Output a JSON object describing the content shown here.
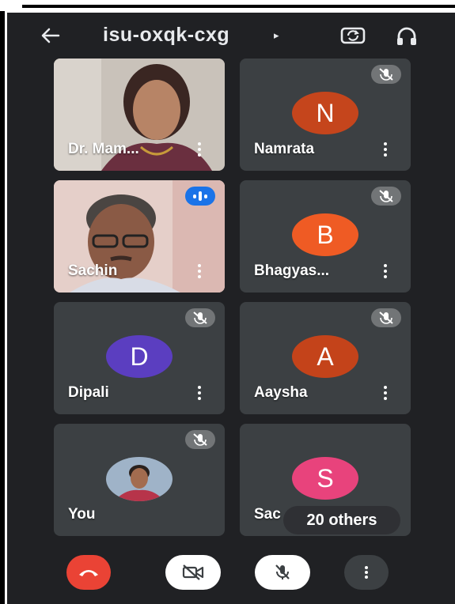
{
  "header": {
    "meeting_code": "isu-oxqk-cxg",
    "back_icon": "arrow-left-icon",
    "switch_camera_icon": "switch-camera-icon",
    "audio_icon": "headphones-icon"
  },
  "participants": [
    {
      "name": "Dr. Mam...",
      "type": "video",
      "state": "unmuted"
    },
    {
      "name": "Namrata",
      "initial": "N",
      "avatar_color": "#c5451c",
      "state": "muted"
    },
    {
      "name": "Sachin",
      "type": "video",
      "state": "speaking"
    },
    {
      "name": "Bhagyas...",
      "initial": "B",
      "avatar_color": "#ef5b24",
      "state": "muted"
    },
    {
      "name": "Dipali",
      "initial": "D",
      "avatar_color": "#5b3ec0",
      "state": "muted"
    },
    {
      "name": "Aaysha",
      "initial": "A",
      "avatar_color": "#c4431a",
      "state": "muted"
    },
    {
      "name": "You",
      "type": "photo",
      "state": "muted"
    },
    {
      "name": "Sac",
      "initial": "S",
      "avatar_color": "#e8437c",
      "state": "unknown"
    }
  ],
  "others_count_label": "20 others",
  "controls": {
    "end_call_icon": "end-call-icon",
    "camera_icon": "camera-off-icon",
    "mic_icon": "mic-off-icon",
    "more_icon": "more-options-icon"
  },
  "colors": {
    "background": "#202124",
    "tile": "#3c4043",
    "end_call": "#ea4335",
    "speaking": "#1a73e8"
  }
}
